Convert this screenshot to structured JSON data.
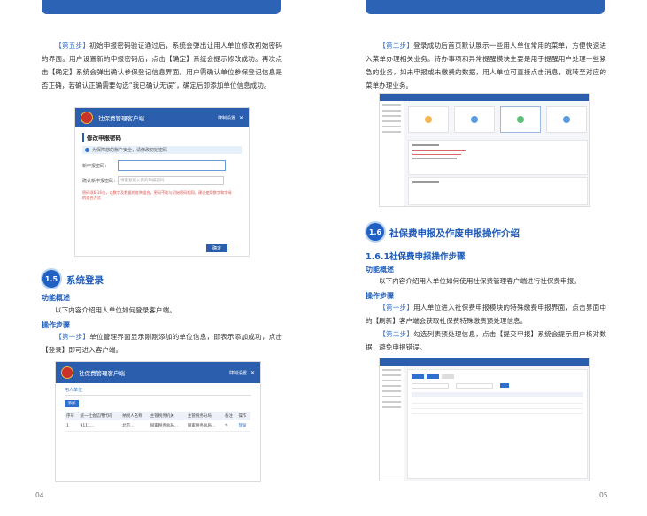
{
  "page_left": {
    "page_number": "04",
    "step5": {
      "tag": "【第五步】",
      "text": "初始申报密码验证通过后，系统会弹出让用人单位修改初始密码的界面。用户设置新的申报密码后，点击【确定】系统会提示修改成功。再次点击【确定】系统会弹出确认参保登记信息界面。用户需确认单位参保登记信息是否正确，若确认正确需要勾选“我已确认无误”，确定后即添加单位信息成功。"
    },
    "dialog": {
      "app_title": "社保费管理客户端",
      "corner_link": "肆制设置",
      "section_title": "修改申报密码",
      "notice": "为保障您的账户安全，请修改初始密码",
      "new_pwd_label": "新申报密码：",
      "confirm_pwd_label": "确认新申报密码：",
      "confirm_pwd_placeholder": "请重复输入新的申报密码",
      "warning": "密码须6-16位，以数字及数据的各种组合，密码不能与初始密码相同，建议使用数字和字母的组合方式",
      "ok_button": "确定"
    },
    "section": {
      "badge": "1.5",
      "title": "系统登录"
    },
    "func_overview": {
      "heading": "功能概述",
      "text": "以下内容介绍用人单位如何登录客户端。"
    },
    "op_steps": {
      "heading": "操作步骤",
      "tag": "【第一步】",
      "text": "单位管理界面显示刚刚添加的单位信息，即表示添加成功，点击【登录】即可进入客户端。"
    },
    "unit_list": {
      "app_title": "社保费管理客户端",
      "corner_link": "肆制设置",
      "tab": "用人单位",
      "add_button": "添加",
      "columns": [
        "序号",
        "统一社会信用代码",
        "纳税人名称",
        "主管税务机关",
        "主管税务分局",
        "备注",
        "操作"
      ],
      "row": [
        "1",
        "9111...",
        "北京...",
        "国家税务总局...",
        "国家税务总局...",
        "",
        "登录"
      ]
    }
  },
  "page_right": {
    "page_number": "05",
    "step2": {
      "tag": "【第二步】",
      "text": "登录成功后首页默认展示一些用人单位常用的菜单，方便快速进入菜单办理相关业务。待办事项和异常提醒模块主要是用于提醒用户处理一些紧急的业务，如未申报或未缴费的数据，用人单位可直接点击消息，跳转至对应的菜单办理业务。"
    },
    "section": {
      "badge": "1.6",
      "title": "社保费申报及作废申报操作介绍"
    },
    "subsection": "1.6.1社保费申报操作步骤",
    "func_overview": {
      "heading": "功能概述",
      "text": "以下内容介绍用人单位如何使用社保费管理客户端进行社保费申报。"
    },
    "op_steps": {
      "heading": "操作步骤",
      "step1_tag": "【第一步】",
      "step1_text": "用人单位进入社保费申报模块的特殊缴费申报界面，点击界面中的【刷新】客户端会获取社保费特殊缴费预处理信息。",
      "step2_tag": "【第二步】",
      "step2_text": "勾选列表预处理信息，点击【提交申报】系统会提示用户核对数据，避免申报错误。"
    }
  }
}
